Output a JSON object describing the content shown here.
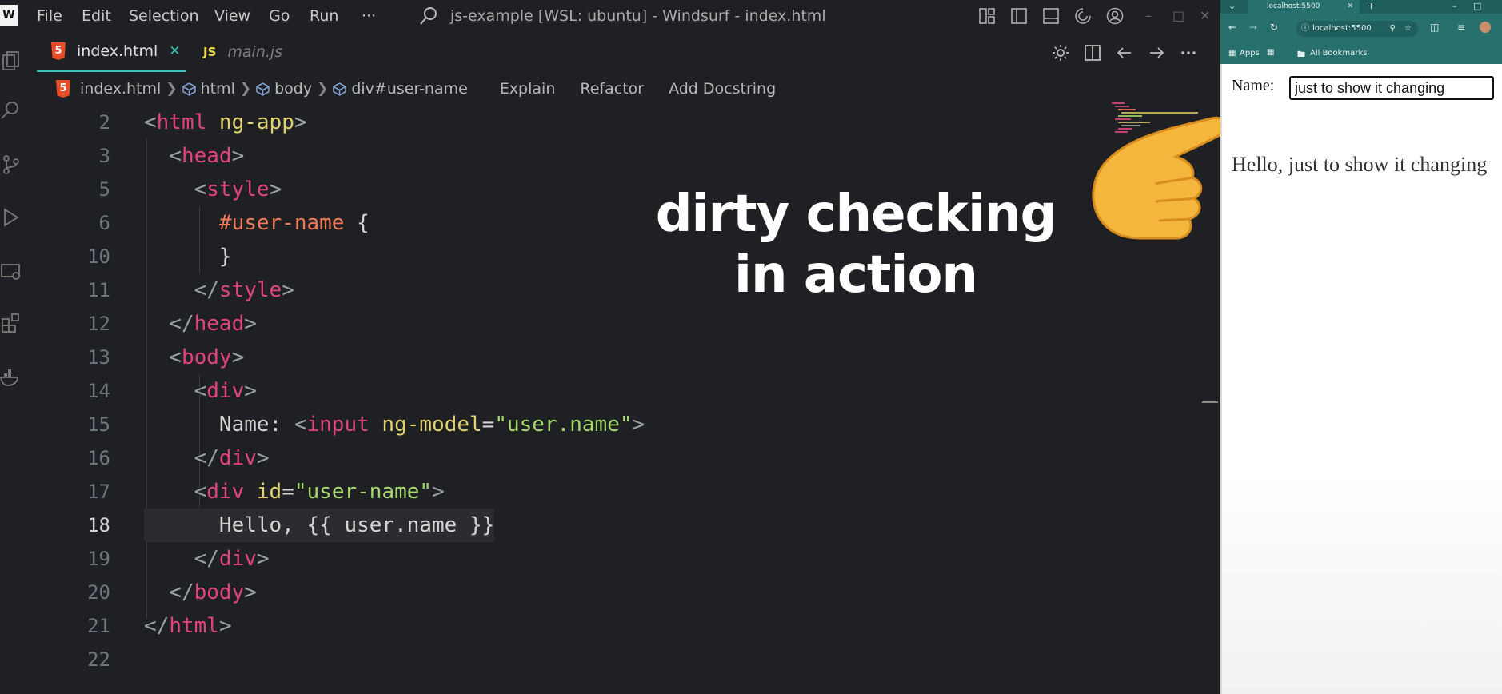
{
  "titlebar": {
    "menu": [
      "File",
      "Edit",
      "Selection",
      "View",
      "Go",
      "Run",
      "···"
    ],
    "title": "js-example [WSL: ubuntu] - Windsurf - index.html"
  },
  "tabs": [
    {
      "label": "index.html",
      "icon": "html5-icon",
      "active": true,
      "close": "✕"
    },
    {
      "label": "main.js",
      "icon": "js-icon",
      "active": false
    }
  ],
  "breadcrumbs": {
    "file": "index.html",
    "items": [
      "html",
      "body",
      "div#user-name"
    ],
    "actions": [
      "Explain",
      "Refactor",
      "Add Docstring"
    ]
  },
  "code": {
    "current_line": "18",
    "lines": [
      {
        "n": "2",
        "parts": [
          [
            "<",
            "br"
          ],
          [
            "html",
            "tag"
          ],
          [
            " ng-app",
            "attr"
          ],
          [
            ">",
            "br"
          ]
        ]
      },
      {
        "n": "3",
        "parts": [
          [
            "  <",
            "br"
          ],
          [
            "head",
            "tag"
          ],
          [
            ">",
            "br"
          ]
        ]
      },
      {
        "n": "5",
        "parts": [
          [
            "    <",
            "br"
          ],
          [
            "style",
            "tag"
          ],
          [
            ">",
            "br"
          ]
        ]
      },
      {
        "n": "6",
        "parts": [
          [
            "      #user-name",
            "sel"
          ],
          [
            " {",
            "txt"
          ]
        ]
      },
      {
        "n": "10",
        "parts": [
          [
            "      }",
            "txt"
          ]
        ]
      },
      {
        "n": "11",
        "parts": [
          [
            "    </",
            "br"
          ],
          [
            "style",
            "tag"
          ],
          [
            ">",
            "br"
          ]
        ]
      },
      {
        "n": "12",
        "parts": [
          [
            "  </",
            "br"
          ],
          [
            "head",
            "tag"
          ],
          [
            ">",
            "br"
          ]
        ]
      },
      {
        "n": "13",
        "parts": [
          [
            "  <",
            "br"
          ],
          [
            "body",
            "tag"
          ],
          [
            ">",
            "br"
          ]
        ]
      },
      {
        "n": "14",
        "parts": [
          [
            "    <",
            "br"
          ],
          [
            "div",
            "tag"
          ],
          [
            ">",
            "br"
          ]
        ]
      },
      {
        "n": "15",
        "parts": [
          [
            "      Name: ",
            "txt"
          ],
          [
            "<",
            "br"
          ],
          [
            "input",
            "tag"
          ],
          [
            " ng-model",
            "attr"
          ],
          [
            "=",
            "txt"
          ],
          [
            "\"user.name\"",
            "str"
          ],
          [
            ">",
            "br"
          ]
        ]
      },
      {
        "n": "16",
        "parts": [
          [
            "    </",
            "br"
          ],
          [
            "div",
            "tag"
          ],
          [
            ">",
            "br"
          ]
        ]
      },
      {
        "n": "17",
        "parts": [
          [
            "    <",
            "br"
          ],
          [
            "div",
            "tag"
          ],
          [
            " id",
            "attr"
          ],
          [
            "=",
            "txt"
          ],
          [
            "\"user-name\"",
            "str"
          ],
          [
            ">",
            "br"
          ]
        ]
      },
      {
        "n": "18",
        "parts": [
          [
            "      Hello, {{ user.name }}",
            "txt"
          ]
        ]
      },
      {
        "n": "19",
        "parts": [
          [
            "    </",
            "br"
          ],
          [
            "div",
            "tag"
          ],
          [
            ">",
            "br"
          ]
        ]
      },
      {
        "n": "20",
        "parts": [
          [
            "  </",
            "br"
          ],
          [
            "body",
            "tag"
          ],
          [
            ">",
            "br"
          ]
        ]
      },
      {
        "n": "21",
        "parts": [
          [
            "</",
            "br"
          ],
          [
            "html",
            "tag"
          ],
          [
            ">",
            "br"
          ]
        ]
      },
      {
        "n": "22",
        "parts": []
      }
    ]
  },
  "overlay": {
    "line1": "dirty checking",
    "line2": "in action"
  },
  "browser": {
    "tab_title": "localhost:5500",
    "url": "localhost:5500",
    "bookmarks": [
      "Apps",
      "All Bookmarks"
    ],
    "name_label": "Name:",
    "input_value": "just to show it changing",
    "hello_text": "Hello, just to show it changing"
  },
  "colors": {
    "tag": "#e0447a",
    "attr": "#e3d36c",
    "string": "#a5d86a",
    "selector": "#f07a59",
    "accent": "#36c2b4",
    "browser_chrome": "#27706d"
  }
}
